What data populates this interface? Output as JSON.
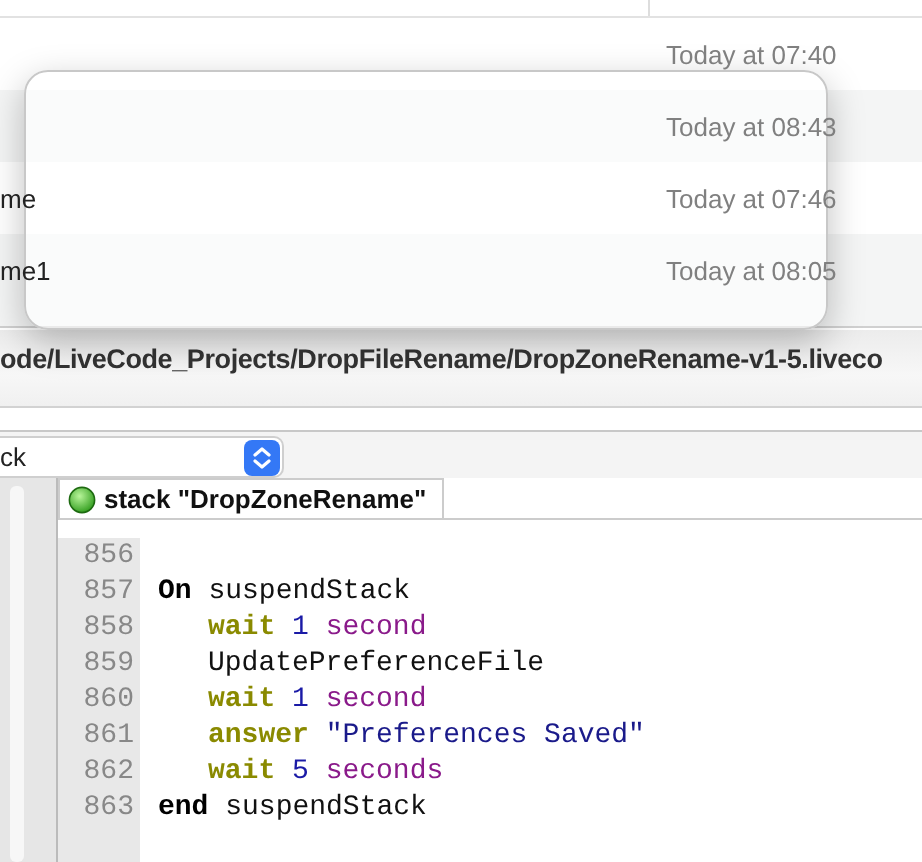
{
  "file_list": {
    "rows": [
      {
        "name": "",
        "date": "Today at 07:40"
      },
      {
        "name": "",
        "date": "Today at 08:43"
      },
      {
        "name": "me",
        "date": "Today at 07:46"
      },
      {
        "name": "me1",
        "date": "Today at 08:05"
      }
    ]
  },
  "path_bar": {
    "path": "ode/LiveCode_Projects/DropFileRename/DropZoneRename-v1-5.liveco"
  },
  "object_select": {
    "value": "ck"
  },
  "editor": {
    "tab": {
      "label": "stack \"DropZoneRename\"",
      "selected": true
    },
    "lines": [
      {
        "number": "856"
      },
      {
        "number": "857",
        "indent": false,
        "tokens": [
          {
            "kind": "keyword",
            "text": "On"
          },
          {
            "kind": "plain",
            "text": " suspendStack"
          }
        ]
      },
      {
        "number": "858",
        "indent": true,
        "tokens": [
          {
            "kind": "command",
            "text": "wait"
          },
          {
            "kind": "number",
            "text": " 1"
          },
          {
            "kind": "constant",
            "text": " second"
          }
        ]
      },
      {
        "number": "859",
        "indent": true,
        "tokens": [
          {
            "kind": "plain",
            "text": "UpdatePreferenceFile"
          }
        ]
      },
      {
        "number": "860",
        "indent": true,
        "tokens": [
          {
            "kind": "command",
            "text": "wait"
          },
          {
            "kind": "number",
            "text": " 1"
          },
          {
            "kind": "constant",
            "text": " second"
          }
        ]
      },
      {
        "number": "861",
        "indent": true,
        "tokens": [
          {
            "kind": "command",
            "text": "answer"
          },
          {
            "kind": "string",
            "text": " \"Preferences Saved\""
          }
        ]
      },
      {
        "number": "862",
        "indent": true,
        "tokens": [
          {
            "kind": "command",
            "text": "wait"
          },
          {
            "kind": "number",
            "text": " 5"
          },
          {
            "kind": "constant",
            "text": " seconds"
          }
        ]
      },
      {
        "number": "863",
        "indent": false,
        "tokens": [
          {
            "kind": "keyword",
            "text": "end"
          },
          {
            "kind": "plain",
            "text": " suspendStack"
          }
        ]
      }
    ]
  }
}
